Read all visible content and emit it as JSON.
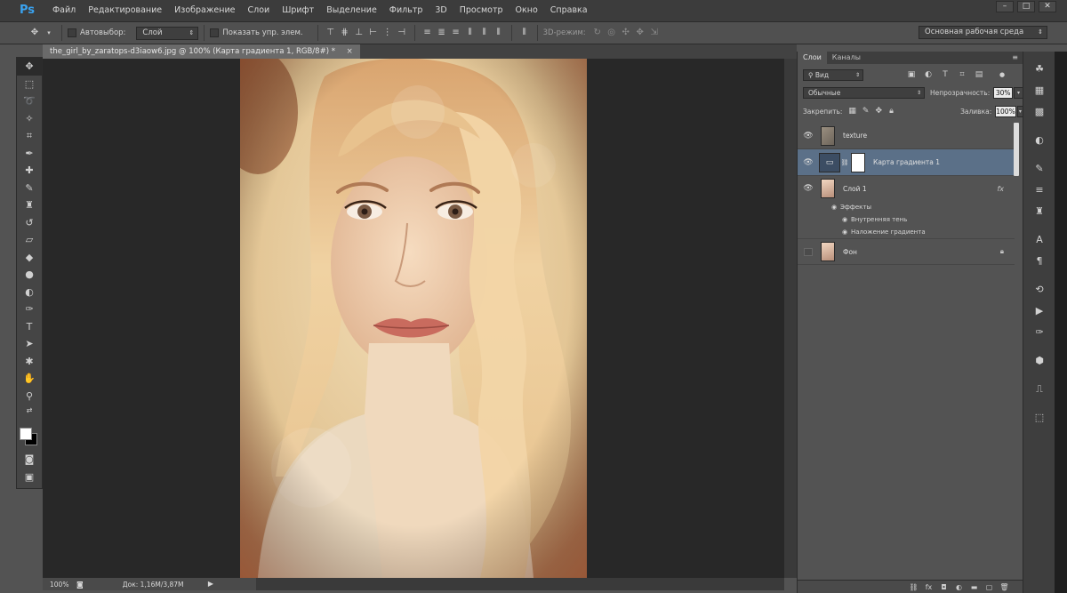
{
  "app": {
    "logo": "Ps"
  },
  "menu": [
    "Файл",
    "Редактирование",
    "Изображение",
    "Слои",
    "Шрифт",
    "Выделение",
    "Фильтр",
    "3D",
    "Просмотр",
    "Окно",
    "Справка"
  ],
  "window_controls": [
    "–",
    "□",
    "✕"
  ],
  "options": {
    "autoselect_label": "Автовыбор:",
    "autoselect_value": "Слой",
    "show_transform_label": "Показать упр. элем.",
    "mode3d_label": "3D-режим:",
    "workspace": "Основная рабочая среда"
  },
  "document": {
    "tab_title": "the_girl_by_zaratops-d3iaow6.jpg @ 100% (Карта градиента 1, RGB/8#) *",
    "tab_close": "×"
  },
  "status": {
    "zoom": "100%",
    "doc_size": "Док: 1,16M/3,87M"
  },
  "panel": {
    "tabs": [
      "Слои",
      "Каналы"
    ],
    "filter_label": "Вид",
    "blend_mode": "Обычные",
    "opacity_label": "Непрозрачность:",
    "opacity_value": "30%",
    "lock_label": "Закрепить:",
    "fill_label": "Заливка:",
    "fill_value": "100%",
    "layers": [
      {
        "name": "texture",
        "visible": true,
        "selected": false
      },
      {
        "name": "Карта градиента 1",
        "visible": true,
        "selected": true
      },
      {
        "name": "Слой 1",
        "visible": true,
        "selected": false,
        "fx": "fx"
      },
      {
        "name": "Фон",
        "visible": false,
        "selected": false,
        "locked": true
      }
    ],
    "effects_label": "Эффекты",
    "effects": [
      "Внутренняя тень",
      "Наложение градиента"
    ]
  },
  "colors": {
    "selected_layer": "#5b7088",
    "ps_logo": "#3aa3f0",
    "canvas_bg": "#282828",
    "panel_bg": "#535353"
  }
}
